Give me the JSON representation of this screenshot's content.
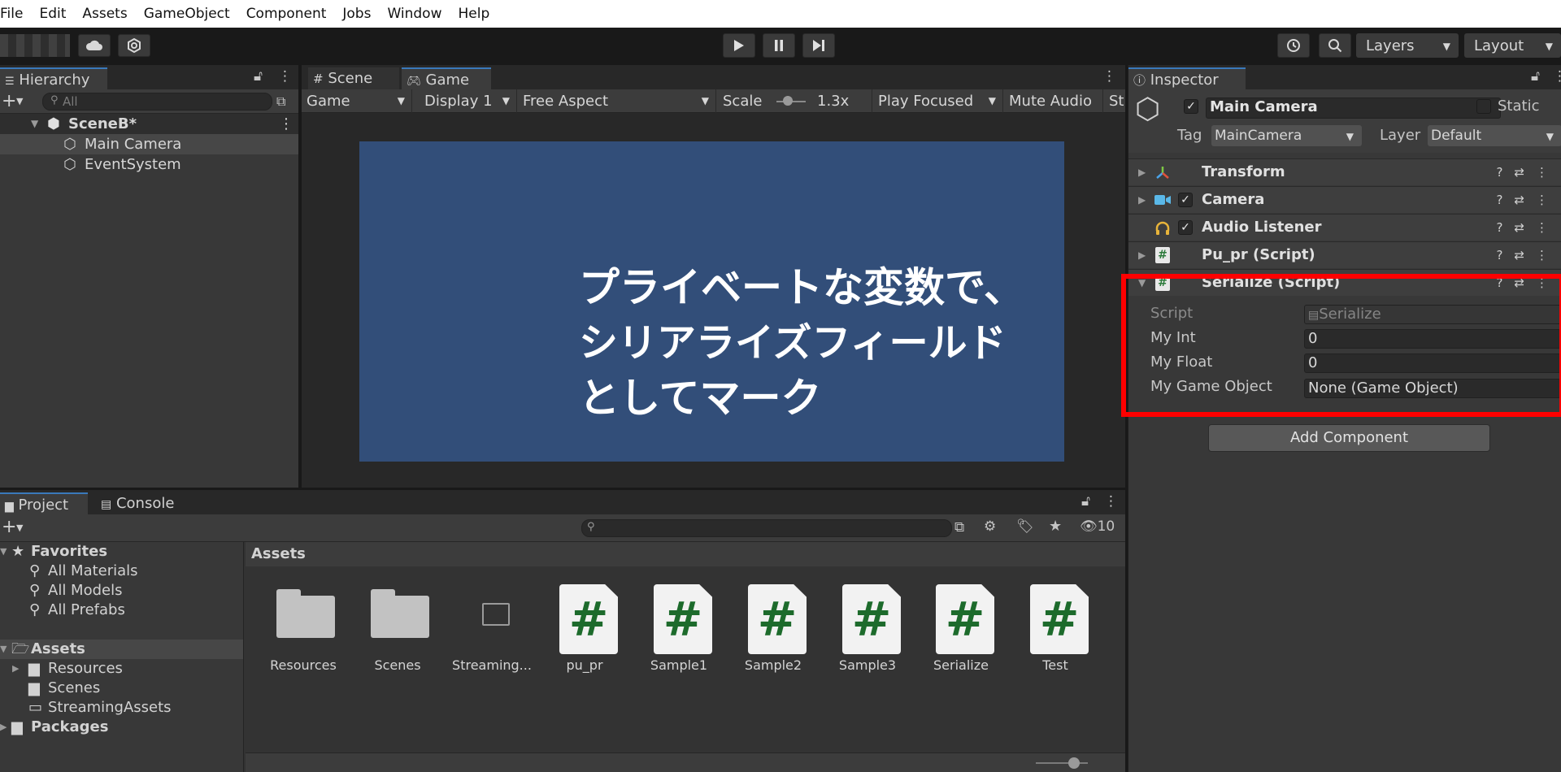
{
  "menu": [
    "File",
    "Edit",
    "Assets",
    "GameObject",
    "Component",
    "Jobs",
    "Window",
    "Help"
  ],
  "toolbar": {
    "layers_label": "Layers",
    "layout_label": "Layout"
  },
  "hierarchy": {
    "tab": "Hierarchy",
    "search_placeholder": "All",
    "scene": "SceneB*",
    "items": [
      "Main Camera",
      "EventSystem"
    ]
  },
  "game_view": {
    "tabs": [
      "Scene",
      "Game"
    ],
    "bar": {
      "mode": "Game",
      "display": "Display 1",
      "aspect": "Free Aspect",
      "scale_label": "Scale",
      "scale_value": "1.3x",
      "play_mode": "Play Focused",
      "mute": "Mute Audio",
      "stats": "St"
    },
    "overlay_lines": [
      "プライベートな変数で、",
      "シリアライズフィールド",
      "としてマーク"
    ],
    "viewport_color": "#324e79"
  },
  "inspector": {
    "tab": "Inspector",
    "object_name": "Main Camera",
    "static_label": "Static",
    "tag_label": "Tag",
    "tag_value": "MainCamera",
    "layer_label": "Layer",
    "layer_value": "Default",
    "components": [
      {
        "name": "Transform",
        "icon": "transform-icon",
        "checkbox": false
      },
      {
        "name": "Camera",
        "icon": "camera-icon",
        "checkbox": true
      },
      {
        "name": "Audio Listener",
        "icon": "headphones-icon",
        "checkbox": true
      },
      {
        "name": "Pu_pr (Script)",
        "icon": "script-icon",
        "checkbox": false
      },
      {
        "name": "Serialize (Script)",
        "icon": "script-icon",
        "checkbox": false
      }
    ],
    "serialize_fields": [
      {
        "label": "Script",
        "value": "Serialize"
      },
      {
        "label": "My Int",
        "value": "0"
      },
      {
        "label": "My Float",
        "value": "0"
      },
      {
        "label": "My Game Object",
        "value": "None (Game Object)"
      }
    ],
    "add_component": "Add Component",
    "highlight_color": "#ff0000"
  },
  "project": {
    "tabs": [
      "Project",
      "Console"
    ],
    "hidden_count": "10",
    "tree": {
      "favorites": "Favorites",
      "fav_items": [
        "All Materials",
        "All Models",
        "All Prefabs"
      ],
      "assets": "Assets",
      "asset_items": [
        "Resources",
        "Scenes",
        "StreamingAssets"
      ],
      "packages": "Packages"
    },
    "assets_header": "Assets",
    "assets": [
      {
        "name": "Resources",
        "kind": "folder"
      },
      {
        "name": "Scenes",
        "kind": "folder"
      },
      {
        "name": "Streaming...",
        "kind": "empty-folder"
      },
      {
        "name": "pu_pr",
        "kind": "script"
      },
      {
        "name": "Sample1",
        "kind": "script"
      },
      {
        "name": "Sample2",
        "kind": "script"
      },
      {
        "name": "Sample3",
        "kind": "script"
      },
      {
        "name": "Serialize",
        "kind": "script"
      },
      {
        "name": "Test",
        "kind": "script"
      }
    ],
    "script_glyph": "#"
  }
}
